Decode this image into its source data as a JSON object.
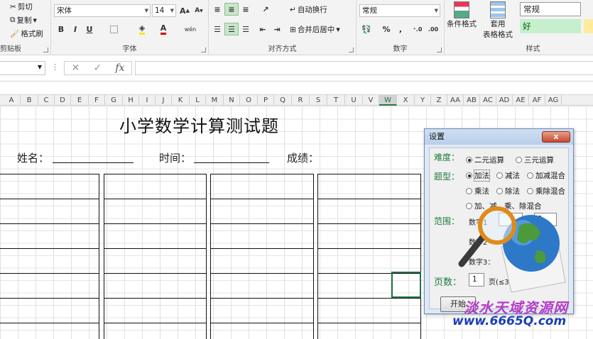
{
  "ribbon": {
    "clipboard": {
      "label": "剪贴板",
      "cut": "剪切",
      "copy": "复制",
      "format_painter": "格式刷"
    },
    "font": {
      "label": "字体",
      "font_name": "宋体",
      "font_size": "14",
      "bold": "B",
      "italic": "I",
      "underline": "U",
      "grow": "A",
      "shrink": "A",
      "color_letter": "A",
      "wen": "wén"
    },
    "alignment": {
      "label": "对齐方式",
      "wrap": "自动换行",
      "merge": "合并后居中"
    },
    "number": {
      "label": "数字",
      "format": "常规",
      "percent": "%",
      "comma": ","
    },
    "styles": {
      "label": "样式",
      "cond_format": "条件格式",
      "table_format_1": "套用",
      "table_format_2": "表格格式",
      "normal": "常规",
      "good": "好"
    }
  },
  "formula_bar": {
    "fx": "fx",
    "cancel": "✕",
    "enter": "✓"
  },
  "columns": [
    "A",
    "B",
    "C",
    "D",
    "E",
    "F",
    "G",
    "H",
    "I",
    "J",
    "K",
    "L",
    "M",
    "N",
    "O",
    "P",
    "Q",
    "R",
    "S",
    "T",
    "U",
    "V",
    "W",
    "X",
    "Y",
    "Z",
    "AA",
    "AB",
    "AC",
    "AD",
    "AE",
    "AF",
    "AG"
  ],
  "sheet": {
    "title": "小学数学计算测试题",
    "name_label": "姓名：",
    "time_label": "时间：",
    "score_label": "成绩："
  },
  "dialog": {
    "title": "设置",
    "close": "x",
    "difficulty_label": "难度：",
    "difficulty_options": [
      "二元运算",
      "三元运算"
    ],
    "type_label": "题型：",
    "type_options": [
      "加法",
      "减法",
      "加减混合",
      "乘法",
      "除法",
      "乘除混合",
      "加、减、乘、除混合"
    ],
    "range_label": "范围：",
    "num1_label": "数字1",
    "num1_value": "",
    "num1_max": "9",
    "num2_label": "数字2",
    "num3_label": "数字3：",
    "pages_label": "页数：",
    "pages_value": "1",
    "pages_unit": "页(≤3",
    "start_button": "开始"
  },
  "watermark": {
    "line1": "淡水天域资源网",
    "line2": "www.6665Q.com"
  },
  "colors": {
    "accent": "#217346",
    "label_green": "#1a7a3c",
    "style_good_bg": "#c6efce",
    "watermark_purple": "#b43cc8",
    "watermark_blue": "#1b3fb5"
  }
}
